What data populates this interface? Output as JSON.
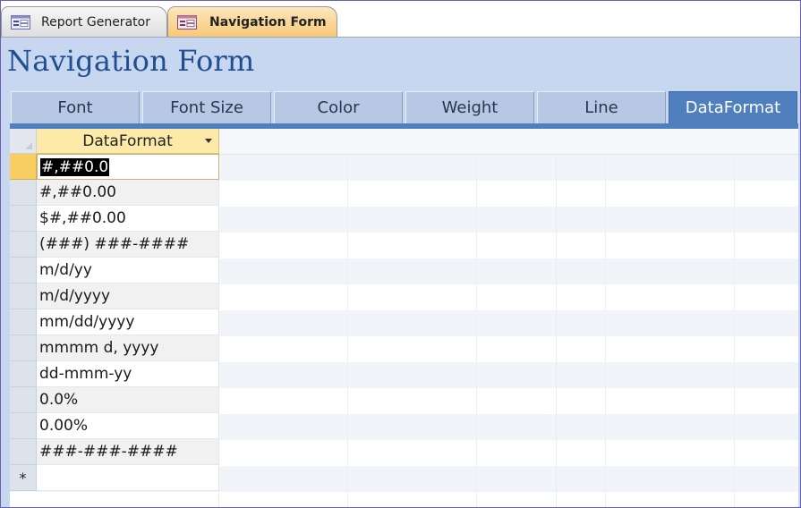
{
  "doc_tabs": [
    {
      "label": "Report Generator",
      "icon": "form-icon",
      "active": false
    },
    {
      "label": "Navigation Form",
      "icon": "form-icon",
      "active": true
    }
  ],
  "form": {
    "title": "Navigation Form"
  },
  "nav_tabs": [
    {
      "label": "Font"
    },
    {
      "label": "Font Size"
    },
    {
      "label": "Color"
    },
    {
      "label": "Weight"
    },
    {
      "label": "Line"
    },
    {
      "label": "DataFormat",
      "selected": true
    }
  ],
  "datasheet": {
    "column_header": "DataFormat",
    "rows": [
      "#,##0.0",
      "#,##0.00",
      "$#,##0.00",
      "(###) ###-####",
      "m/d/yy",
      "m/d/yyyy",
      "mm/dd/yyyy",
      "mmmm d, yyyy",
      "dd-mmm-yy",
      "0.0%",
      "0.00%",
      "###-###-####"
    ],
    "new_record_marker": "*"
  },
  "colors": {
    "accent": "#4f7fbd",
    "header_band": "#c6d7ef",
    "title": "#1f4e91",
    "active_doc_tab": "#f7c978",
    "column_header": "#fde9a8",
    "current_row_selector": "#f8cd62"
  }
}
